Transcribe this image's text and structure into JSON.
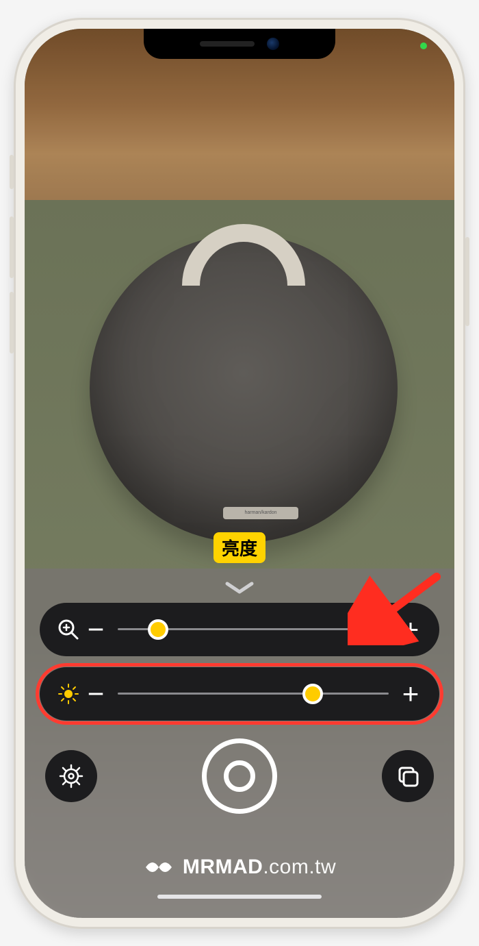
{
  "viewfinder": {
    "subject_brand": "harman/kardon",
    "tooltip_label": "亮度"
  },
  "controls": {
    "zoom": {
      "icon": "magnifier-plus-icon",
      "minus_label": "−",
      "plus_label": "+",
      "thumb_position_pct": 15
    },
    "brightness": {
      "icon": "brightness-icon",
      "minus_label": "−",
      "plus_label": "+",
      "thumb_position_pct": 72,
      "highlighted": true
    }
  },
  "bottom": {
    "settings_label": "settings",
    "freeze_label": "freeze-frame",
    "multi_window_label": "multi-window"
  },
  "watermark": {
    "brand": "MRMAD",
    "suffix": ".com.tw"
  },
  "annotation": {
    "arrow": "pointing to brightness slider"
  }
}
